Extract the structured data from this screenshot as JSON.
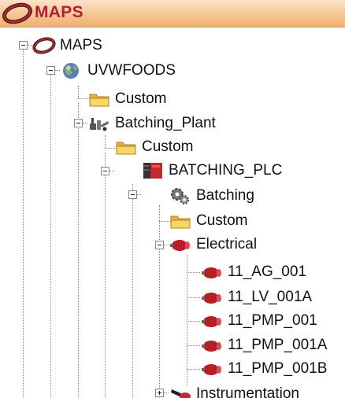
{
  "header": {
    "title": "MAPS",
    "icon": "maps-logo-icon"
  },
  "tree": {
    "nodes": [
      {
        "label": "MAPS",
        "icon": "maps-logo-icon",
        "expanded": true
      },
      {
        "label": "UVWFOODS",
        "icon": "globe-icon",
        "expanded": true
      },
      {
        "label": "Custom",
        "icon": "folder-icon"
      },
      {
        "label": "Batching_Plant",
        "icon": "plant-icon",
        "expanded": true
      },
      {
        "label": "Custom",
        "icon": "folder-icon"
      },
      {
        "label": "BATCHING_PLC",
        "icon": "plc-icon",
        "expanded": true
      },
      {
        "label": "Batching",
        "icon": "gears-icon",
        "expanded": true
      },
      {
        "label": "Custom",
        "icon": "folder-icon"
      },
      {
        "label": "Electrical",
        "icon": "motor-icon",
        "expanded": true
      },
      {
        "label": "11_AG_001",
        "icon": "motor-icon"
      },
      {
        "label": "11_LV_001A",
        "icon": "motor-icon"
      },
      {
        "label": "11_PMP_001",
        "icon": "motor-icon"
      },
      {
        "label": "11_PMP_001A",
        "icon": "motor-icon"
      },
      {
        "label": "11_PMP_001B",
        "icon": "motor-icon"
      },
      {
        "label": "Instrumentation",
        "icon": "instrument-icon",
        "expanded": false
      }
    ]
  },
  "colors": {
    "header_gradient_top": "#fbe3c8",
    "header_gradient_bottom": "#f0b070",
    "header_title": "#b0203a",
    "motor_red": "#c8262e",
    "folder_yellow": "#f3c94a"
  }
}
